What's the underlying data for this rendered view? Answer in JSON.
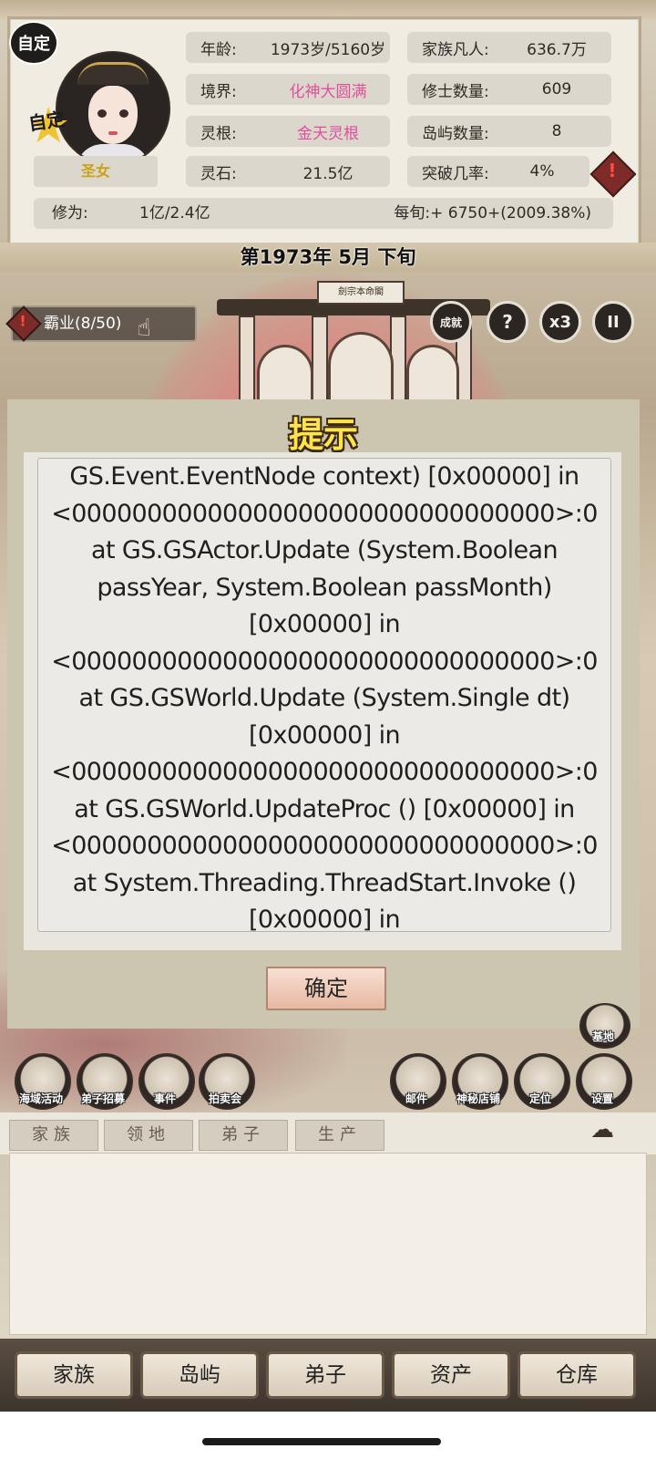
{
  "status": {
    "custom_badge": "自定",
    "star_badge": "自定",
    "title": "圣女",
    "age_label": "年龄:",
    "age_value": "1973岁/5160岁",
    "realm_label": "境界:",
    "realm_value": "化神大圆满",
    "root_label": "灵根:",
    "root_value": "金天灵根",
    "stone_label": "灵石:",
    "stone_value": "21.5亿",
    "mortals_label": "家族凡人:",
    "mortals_value": "636.7万",
    "cultivators_label": "修士数量:",
    "cultivators_value": "609",
    "islands_label": "岛屿数量:",
    "islands_value": "8",
    "breakthrough_label": "突破几率:",
    "breakthrough_value": "4%",
    "cultivation_label": "修为:",
    "cultivation_value": "1亿/2.4亿",
    "per_period": "每旬:+ 6750+(2009.38%)"
  },
  "date": "第1973年 5月 下旬",
  "hegemony": "霸业(8/50)",
  "top_icons": {
    "speed": "x3",
    "help": "?",
    "pause": "II",
    "achievement": "成就"
  },
  "gate_sign": "劍宗本命閣",
  "dialog": {
    "title": "提示",
    "lines": [
      "GS.Event.EventNode context) [0x00000] in",
      "<00000000000000000000000000000000>:0",
      "at GS.GSActor.Update (System.Boolean",
      "passYear, System.Boolean passMonth)",
      "[0x00000] in",
      "<00000000000000000000000000000000>:0",
      "at GS.GSWorld.Update (System.Single dt)",
      "[0x00000] in",
      "<00000000000000000000000000000000>:0",
      "at GS.GSWorld.UpdateProc () [0x00000] in",
      "<00000000000000000000000000000000>:0",
      "at System.Threading.ThreadStart.Invoke ()",
      "[0x00000] in"
    ],
    "confirm": "确定"
  },
  "actions": {
    "base": "基地",
    "sea": "海域活动",
    "recruit": "弟子招募",
    "events": "事件",
    "auction": "拍卖会",
    "mail": "邮件",
    "shop": "神秘店铺",
    "locate": "定位",
    "settings": "设置"
  },
  "tabs": [
    "家族",
    "领地",
    "弟子",
    "生产"
  ],
  "nav": [
    "家族",
    "岛屿",
    "弟子",
    "资产",
    "仓库"
  ],
  "colors": {
    "realm_pink": "#e04f9d",
    "title_gold": "#c9a21b",
    "dialog_title": "#ffe34d"
  }
}
